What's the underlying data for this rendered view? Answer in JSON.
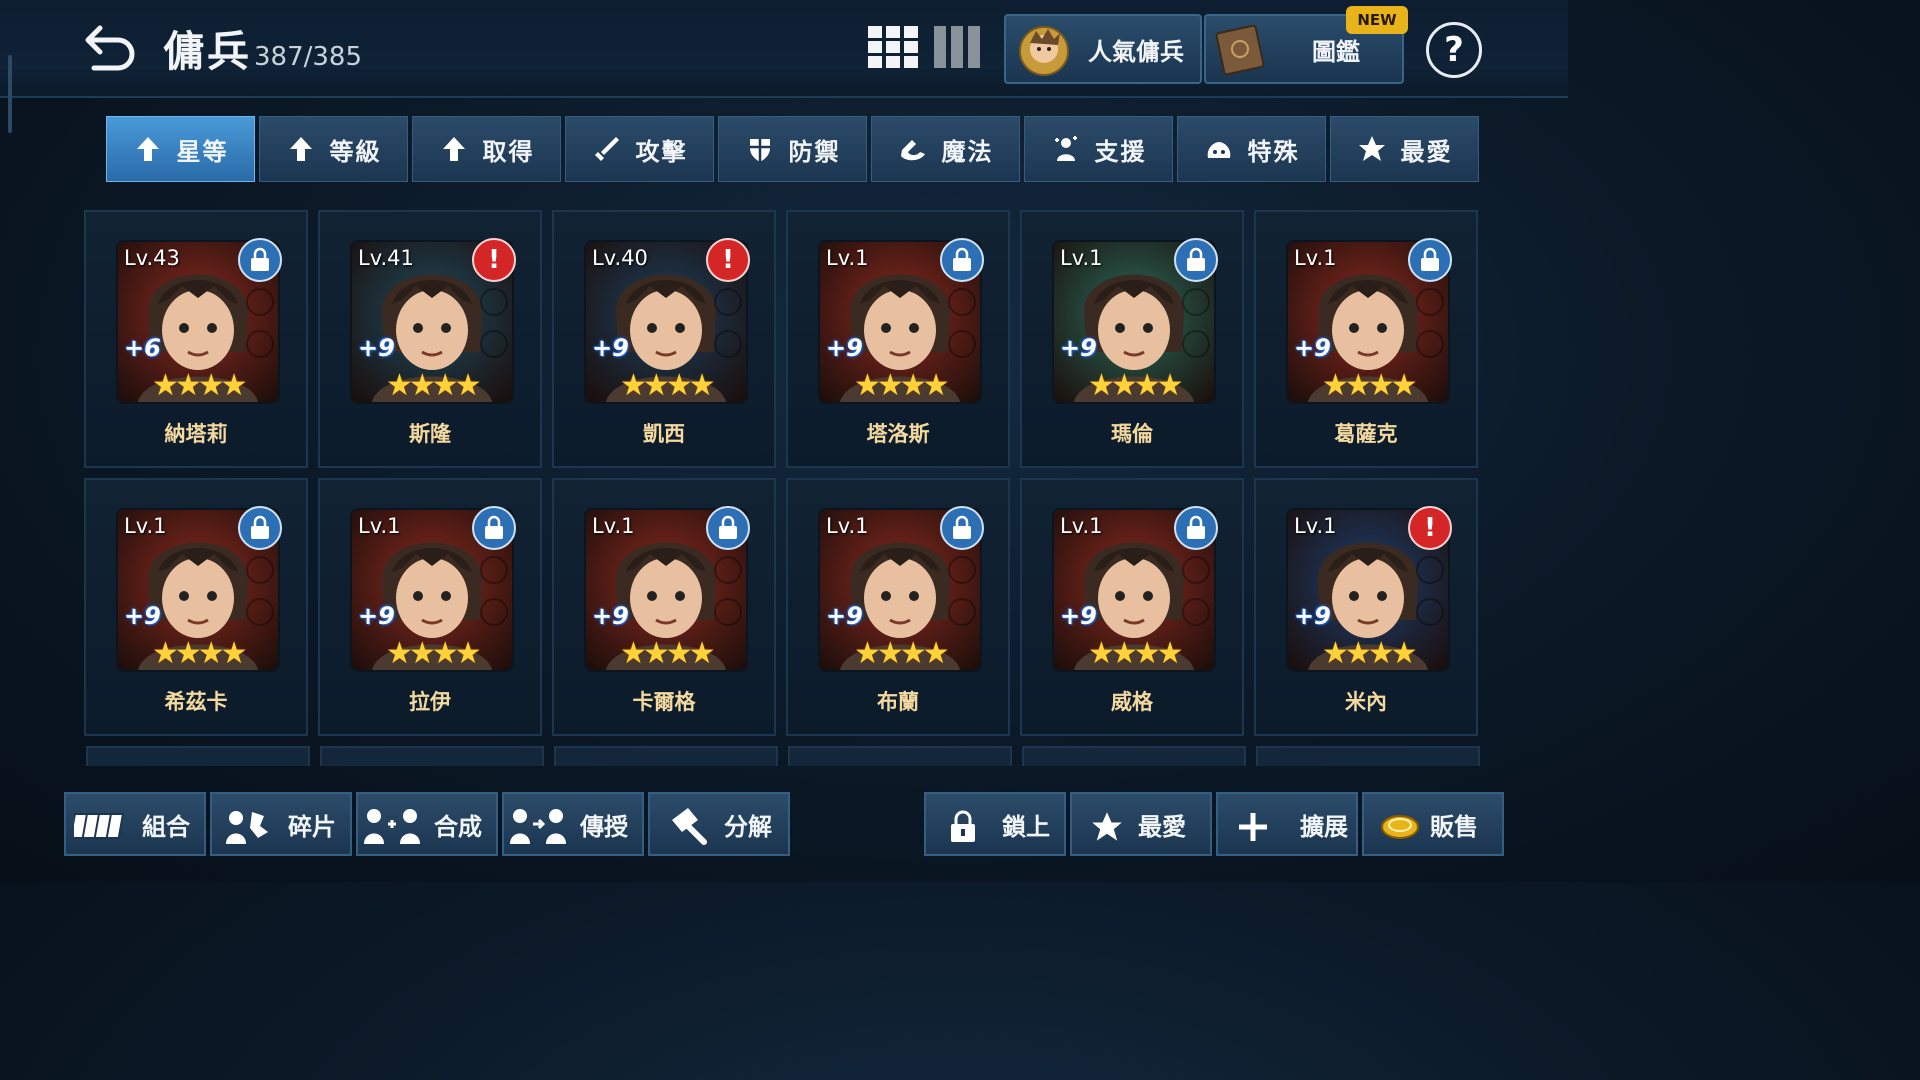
{
  "header": {
    "title": "傭兵",
    "count": "387/385",
    "popular_label": "人氣傭兵",
    "codex_label": "圖鑑",
    "new_badge": "NEW",
    "help_label": "?"
  },
  "tabs": [
    {
      "label": "星等",
      "icon": "up-arrow-icon",
      "active": true
    },
    {
      "label": "等級",
      "icon": "up-arrow-icon",
      "active": false
    },
    {
      "label": "取得",
      "icon": "up-arrow-icon",
      "active": false
    },
    {
      "label": "攻擊",
      "icon": "sword-icon",
      "active": false
    },
    {
      "label": "防禦",
      "icon": "shield-icon",
      "active": false
    },
    {
      "label": "魔法",
      "icon": "magic-icon",
      "active": false
    },
    {
      "label": "支援",
      "icon": "support-icon",
      "active": false
    },
    {
      "label": "特殊",
      "icon": "special-icon",
      "active": false
    },
    {
      "label": "最愛",
      "icon": "star-icon",
      "active": false
    }
  ],
  "mercenaries": [
    {
      "name": "納塔莉",
      "level": "Lv.43",
      "plus": "+6",
      "stars": "★★★★",
      "status": "lock",
      "bg": "#8a2a20"
    },
    {
      "name": "斯隆",
      "level": "Lv.41",
      "plus": "+9",
      "stars": "★★★★",
      "status": "alert",
      "bg": "#1f4a5e"
    },
    {
      "name": "凱西",
      "level": "Lv.40",
      "plus": "+9",
      "stars": "★★★★",
      "status": "alert",
      "bg": "#1e3f5c"
    },
    {
      "name": "塔洛斯",
      "level": "Lv.1",
      "plus": "+9",
      "stars": "★★★★",
      "status": "lock",
      "bg": "#8a2a20"
    },
    {
      "name": "瑪倫",
      "level": "Lv.1",
      "plus": "+9",
      "stars": "★★★★",
      "status": "lock",
      "bg": "#2b6a5a"
    },
    {
      "name": "葛薩克",
      "level": "Lv.1",
      "plus": "+9",
      "stars": "★★★★",
      "status": "lock",
      "bg": "#8a2a20"
    },
    {
      "name": "希茲卡",
      "level": "Lv.1",
      "plus": "+9",
      "stars": "★★★★",
      "status": "lock",
      "bg": "#8a2a20"
    },
    {
      "name": "拉伊",
      "level": "Lv.1",
      "plus": "+9",
      "stars": "★★★★",
      "status": "lock",
      "bg": "#8a2a20"
    },
    {
      "name": "卡爾格",
      "level": "Lv.1",
      "plus": "+9",
      "stars": "★★★★",
      "status": "lock",
      "bg": "#8a2a20"
    },
    {
      "name": "布蘭",
      "level": "Lv.1",
      "plus": "+9",
      "stars": "★★★★",
      "status": "lock",
      "bg": "#8a2a20"
    },
    {
      "name": "威格",
      "level": "Lv.1",
      "plus": "+9",
      "stars": "★★★★",
      "status": "lock",
      "bg": "#8a2a20"
    },
    {
      "name": "米內",
      "level": "Lv.1",
      "plus": "+9",
      "stars": "★★★★",
      "status": "alert",
      "bg": "#1e3f6c"
    }
  ],
  "bottom": {
    "combine": "組合",
    "fragments": "碎片",
    "synthesize": "合成",
    "transfer": "傳授",
    "decompose": "分解",
    "lock": "鎖上",
    "favorite": "最愛",
    "expand": "擴展",
    "sell": "販售"
  },
  "colors": {
    "accent_tab": "#3f8fd0",
    "lock_badge": "#2d6fb5",
    "alert_badge": "#d42626",
    "star": "#ffd23a",
    "name_text": "#f3d9a0"
  }
}
